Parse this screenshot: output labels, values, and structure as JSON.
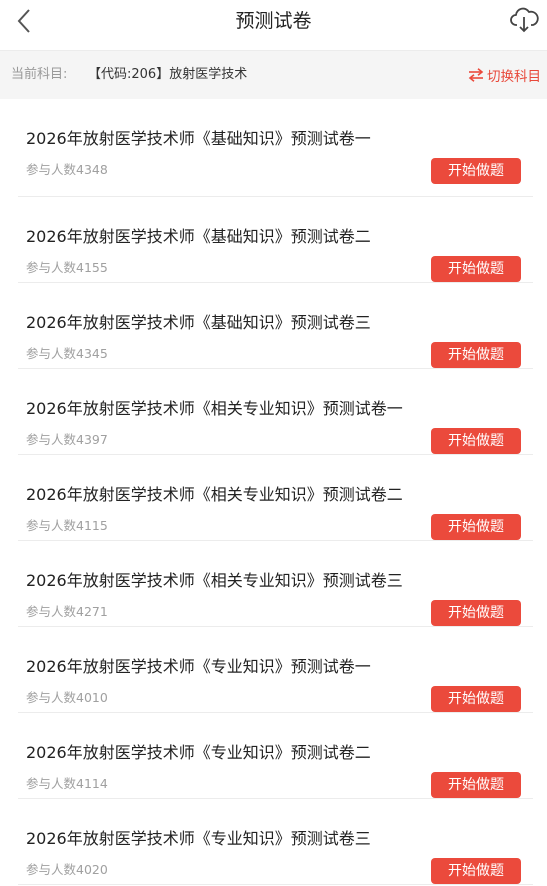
{
  "header": {
    "title": "预测试卷",
    "back_icon": "chevron-left-icon",
    "download_icon": "cloud-download-icon"
  },
  "subject": {
    "label": "当前科目:",
    "value": "【代码:206】放射医学技术",
    "switch_label": "切换科目",
    "switch_icon": "swap-icon",
    "accent_color": "#eb4a3c"
  },
  "papers": [
    {
      "title": "2026年放射医学技术师《基础知识》预测试卷一",
      "participants": "参与人数4348",
      "button": "开始做题"
    },
    {
      "title": "2026年放射医学技术师《基础知识》预测试卷二",
      "participants": "参与人数4155",
      "button": "开始做题"
    },
    {
      "title": "2026年放射医学技术师《基础知识》预测试卷三",
      "participants": "参与人数4345",
      "button": "开始做题"
    },
    {
      "title": "2026年放射医学技术师《相关专业知识》预测试卷一",
      "participants": "参与人数4397",
      "button": "开始做题"
    },
    {
      "title": "2026年放射医学技术师《相关专业知识》预测试卷二",
      "participants": "参与人数4115",
      "button": "开始做题"
    },
    {
      "title": "2026年放射医学技术师《相关专业知识》预测试卷三",
      "participants": "参与人数4271",
      "button": "开始做题"
    },
    {
      "title": "2026年放射医学技术师《专业知识》预测试卷一",
      "participants": "参与人数4010",
      "button": "开始做题"
    },
    {
      "title": "2026年放射医学技术师《专业知识》预测试卷二",
      "participants": "参与人数4114",
      "button": "开始做题"
    },
    {
      "title": "2026年放射医学技术师《专业知识》预测试卷三",
      "participants": "参与人数4020",
      "button": "开始做题"
    }
  ]
}
